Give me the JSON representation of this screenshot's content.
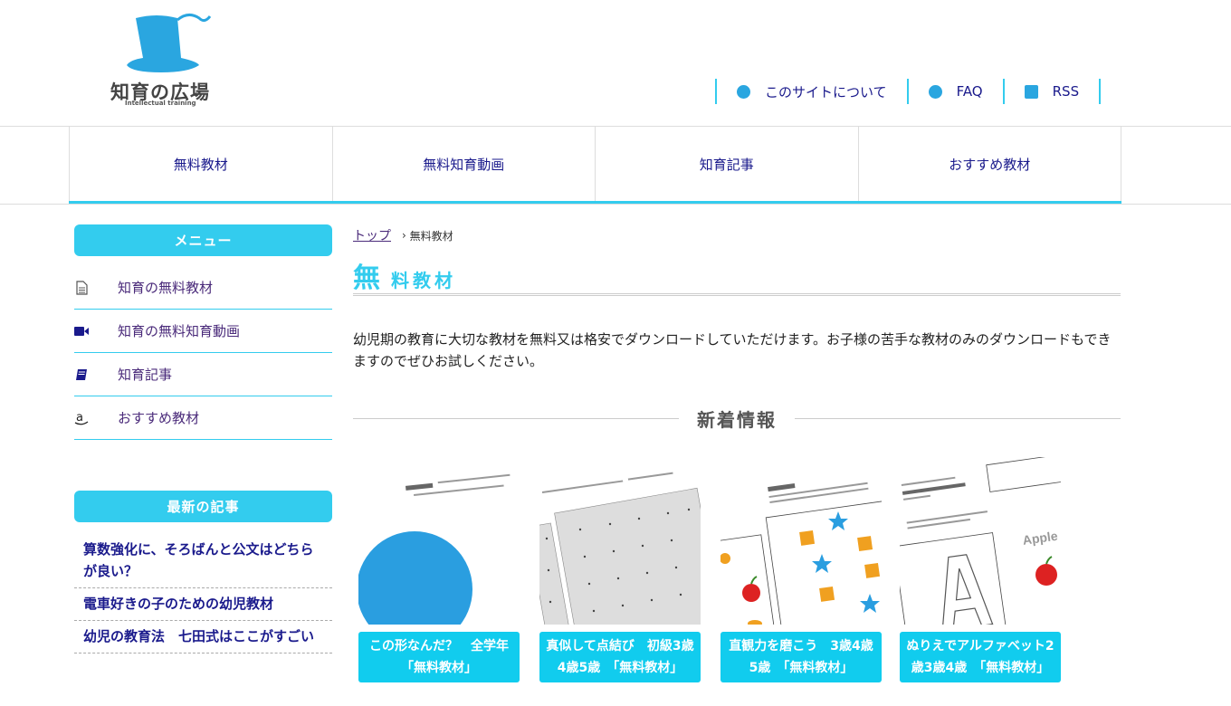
{
  "header": {
    "logo_text": "知育の広場",
    "logo_sub": "Intellectual training",
    "links": [
      {
        "label": "このサイトについて",
        "icon": "chat-bubble-icon"
      },
      {
        "label": "FAQ",
        "icon": "question-icon"
      },
      {
        "label": "RSS",
        "icon": "rss-icon"
      }
    ]
  },
  "nav": {
    "items": [
      "無料教材",
      "無料知育動画",
      "知育記事",
      "おすすめ教材"
    ]
  },
  "sidebar": {
    "menu_title": "メニュー",
    "menu": [
      {
        "label": "知育の無料教材",
        "icon": "document-icon"
      },
      {
        "label": "知育の無料知育動画",
        "icon": "video-camera-icon"
      },
      {
        "label": "知育記事",
        "icon": "book-icon"
      },
      {
        "label": "おすすめ教材",
        "icon": "amazon-icon"
      }
    ],
    "latest_title": "最新の記事",
    "articles": [
      "算数強化に、そろばんと公文はどちらが良い？",
      "電車好きの子のための幼児教材",
      "幼児の教育法　七田式はここがすごい"
    ]
  },
  "main": {
    "breadcrumb": {
      "home": "トップ",
      "current": "無料教材"
    },
    "title_first": "無",
    "title_rest": "料教材",
    "intro": "幼児期の教育に大切な教材を無料又は格安でダウンロードしていただけます。お子様の苦手な教材のみのダウンロードもできますのでぜひお試しください。",
    "news_title": "新着情報",
    "cards": [
      {
        "caption": "この形なんだ？　全学年　「無料教材」"
      },
      {
        "caption": "真似して点結び　初級3歳4歳5歳　「無料教材」"
      },
      {
        "caption": "直観力を磨こう　3歳4歳5歳　「無料教材」"
      },
      {
        "caption": "ぬりえでアルファベット2歳3歳4歳　「無料教材」",
        "thumb_word": "Apple",
        "thumb_letter": "A"
      }
    ]
  },
  "colors": {
    "accent": "#33ccee",
    "caption_bg": "#11ccee",
    "link": "#1a1a8c"
  }
}
